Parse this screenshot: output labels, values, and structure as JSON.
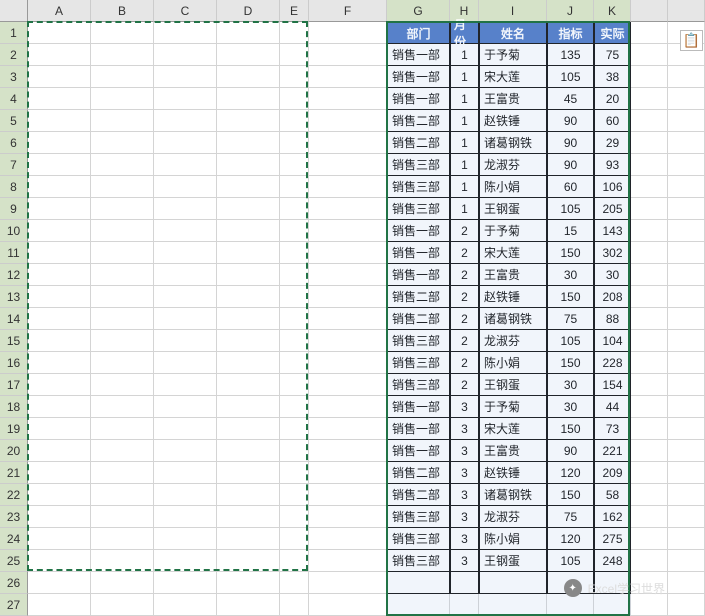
{
  "columns": [
    "A",
    "B",
    "C",
    "D",
    "E",
    "F",
    "G",
    "H",
    "I",
    "J",
    "K"
  ],
  "rowCount": 27,
  "selectedCols": [
    "G",
    "H",
    "I",
    "J",
    "K"
  ],
  "marchingAnts": {
    "cols": [
      "A",
      "B",
      "C",
      "D",
      "E"
    ],
    "rowStart": 1,
    "rowEnd": 25
  },
  "headers": {
    "G": "部门",
    "H": "月份",
    "I": "姓名",
    "J": "指标",
    "K": "实际"
  },
  "rows": [
    {
      "dept": "销售一部",
      "month": 1,
      "name": "于予菊",
      "target": 135,
      "actual": 75
    },
    {
      "dept": "销售一部",
      "month": 1,
      "name": "宋大莲",
      "target": 105,
      "actual": 38
    },
    {
      "dept": "销售一部",
      "month": 1,
      "name": "王富贵",
      "target": 45,
      "actual": 20
    },
    {
      "dept": "销售二部",
      "month": 1,
      "name": "赵铁锤",
      "target": 90,
      "actual": 60
    },
    {
      "dept": "销售二部",
      "month": 1,
      "name": "诸葛钢铁",
      "target": 90,
      "actual": 29
    },
    {
      "dept": "销售三部",
      "month": 1,
      "name": "龙淑芬",
      "target": 90,
      "actual": 93
    },
    {
      "dept": "销售三部",
      "month": 1,
      "name": "陈小娟",
      "target": 60,
      "actual": 106
    },
    {
      "dept": "销售三部",
      "month": 1,
      "name": "王钢蛋",
      "target": 105,
      "actual": 205
    },
    {
      "dept": "销售一部",
      "month": 2,
      "name": "于予菊",
      "target": 15,
      "actual": 143
    },
    {
      "dept": "销售一部",
      "month": 2,
      "name": "宋大莲",
      "target": 150,
      "actual": 302
    },
    {
      "dept": "销售一部",
      "month": 2,
      "name": "王富贵",
      "target": 30,
      "actual": 30
    },
    {
      "dept": "销售二部",
      "month": 2,
      "name": "赵铁锤",
      "target": 150,
      "actual": 208
    },
    {
      "dept": "销售二部",
      "month": 2,
      "name": "诸葛钢铁",
      "target": 75,
      "actual": 88
    },
    {
      "dept": "销售三部",
      "month": 2,
      "name": "龙淑芬",
      "target": 105,
      "actual": 104
    },
    {
      "dept": "销售三部",
      "month": 2,
      "name": "陈小娟",
      "target": 150,
      "actual": 228
    },
    {
      "dept": "销售三部",
      "month": 2,
      "name": "王钢蛋",
      "target": 30,
      "actual": 154
    },
    {
      "dept": "销售一部",
      "month": 3,
      "name": "于予菊",
      "target": 30,
      "actual": 44
    },
    {
      "dept": "销售一部",
      "month": 3,
      "name": "宋大莲",
      "target": 150,
      "actual": 73
    },
    {
      "dept": "销售一部",
      "month": 3,
      "name": "王富贵",
      "target": 90,
      "actual": 221
    },
    {
      "dept": "销售二部",
      "month": 3,
      "name": "赵铁锤",
      "target": 120,
      "actual": 209
    },
    {
      "dept": "销售二部",
      "month": 3,
      "name": "诸葛钢铁",
      "target": 150,
      "actual": 58
    },
    {
      "dept": "销售三部",
      "month": 3,
      "name": "龙淑芬",
      "target": 75,
      "actual": 162
    },
    {
      "dept": "销售三部",
      "month": 3,
      "name": "陈小娟",
      "target": 120,
      "actual": 275
    },
    {
      "dept": "销售三部",
      "month": 3,
      "name": "王钢蛋",
      "target": 105,
      "actual": 248
    }
  ],
  "pasteIcon": "📋",
  "watermark": "Excel学习世界"
}
